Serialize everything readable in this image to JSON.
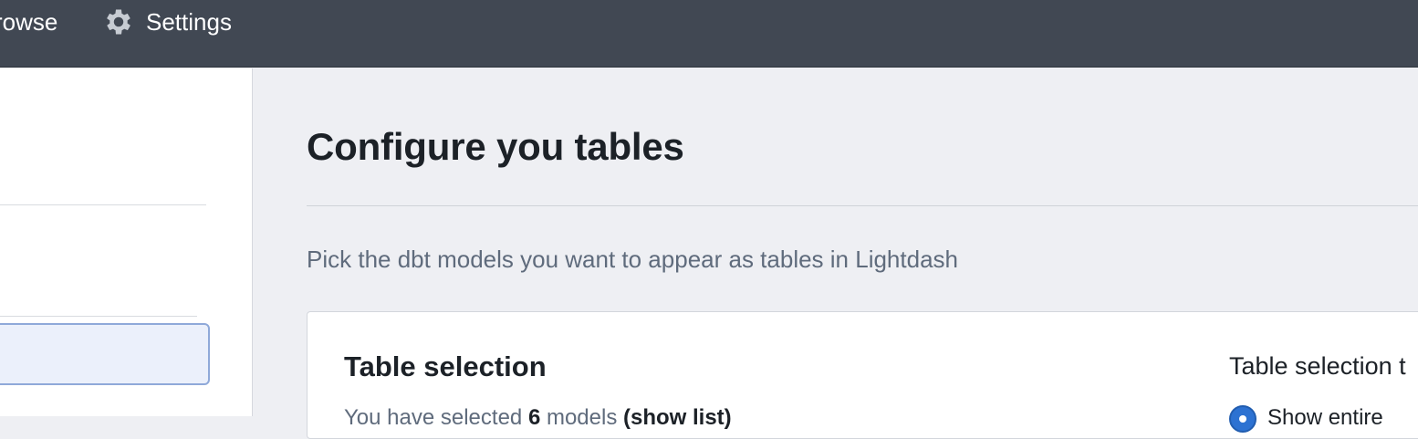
{
  "navbar": {
    "browse_label": "rowse",
    "settings_label": "Settings",
    "settings_icon": "gear-icon"
  },
  "page": {
    "title": "Configure you tables",
    "subtitle": "Pick the dbt models you want to appear as tables in Lightdash"
  },
  "table_selection": {
    "title": "Table selection",
    "summary_prefix": "You have selected ",
    "count": "6",
    "summary_middle": " models ",
    "show_list_label": "(show list)",
    "type_title": "Table selection t",
    "option_label": "Show entire"
  },
  "colors": {
    "navbar_bg": "#414853",
    "page_bg": "#eeeff3",
    "accent": "#2d72d2"
  }
}
